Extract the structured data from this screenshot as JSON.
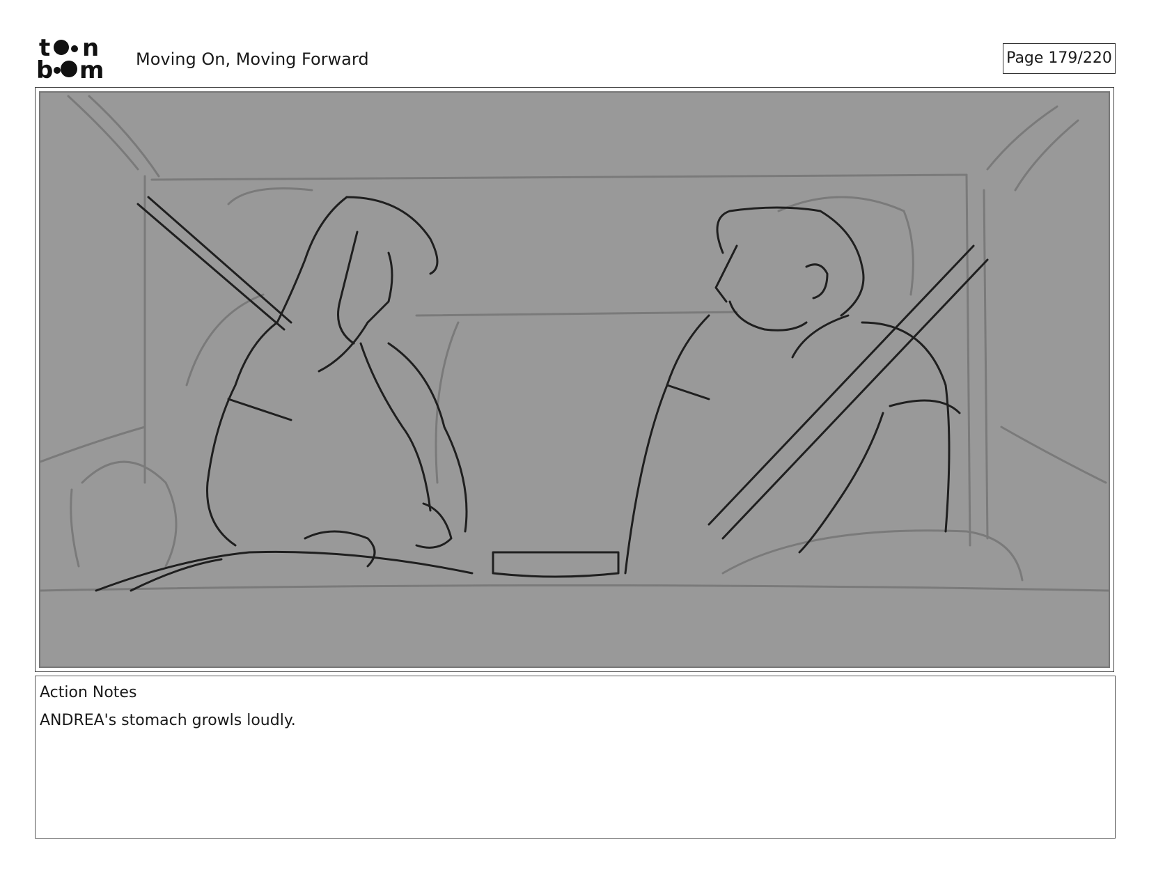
{
  "header": {
    "logo_text": "toon boom",
    "title": "Moving On, Moving Forward",
    "page_label": "Page 179/220"
  },
  "panel": {
    "background_color": "#999999",
    "line_color_dark": "#1f1f1f",
    "line_color_light": "#7a7a7a"
  },
  "notes": {
    "heading": "Action Notes",
    "text": "ANDREA's stomach growls loudly."
  }
}
